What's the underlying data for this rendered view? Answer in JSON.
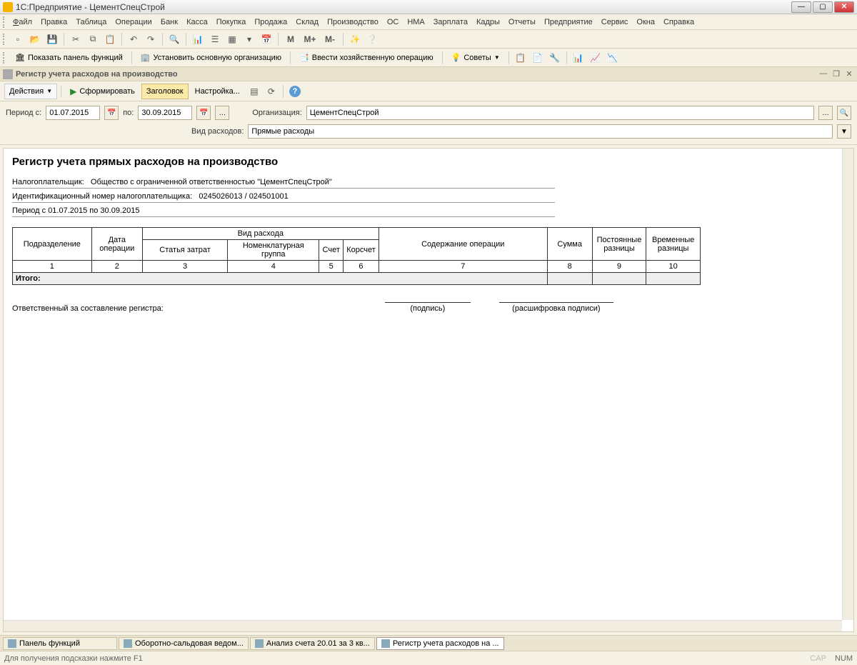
{
  "titlebar": {
    "title": "1С:Предприятие - ЦементСпецСтрой"
  },
  "menu": {
    "items": [
      "Файл",
      "Правка",
      "Таблица",
      "Операции",
      "Банк",
      "Касса",
      "Покупка",
      "Продажа",
      "Склад",
      "Производство",
      "ОС",
      "НМА",
      "Зарплата",
      "Кадры",
      "Отчеты",
      "Предприятие",
      "Сервис",
      "Окна",
      "Справка"
    ]
  },
  "toolbar2": {
    "show_panel": "Показать панель функций",
    "set_org": "Установить основную организацию",
    "enter_op": "Ввести хозяйственную операцию",
    "tips": "Советы"
  },
  "doc_tab": {
    "title": "Регистр учета расходов на производство"
  },
  "actionbar": {
    "actions": "Действия",
    "form": "Сформировать",
    "header": "Заголовок",
    "settings": "Настройка..."
  },
  "filters": {
    "period_from_label": "Период с:",
    "period_from": "01.07.2015",
    "period_to_label": "по:",
    "period_to": "30.09.2015",
    "org_label": "Организация:",
    "org_value": "ЦементСпецСтрой",
    "expense_type_label": "Вид расходов:",
    "expense_type_value": "Прямые расходы"
  },
  "report": {
    "title": "Регистр учета прямых расходов на производство",
    "taxpayer_label": "Налогоплательщик:",
    "taxpayer_value": "Общество с ограниченной ответственностью \"ЦементСпецСтрой\"",
    "inn_label": "Идентификационный номер налогоплательщика:",
    "inn_value": "0245026013 / 024501001",
    "period_line": "Период с 01.07.2015  по 30.09.2015",
    "headers": {
      "dept": "Подразделение",
      "op_date": "Дата операции",
      "exp_type": "Вид расхода",
      "cost_item": "Статья затрат",
      "nomen_group": "Номенклатурная группа",
      "account": "Счет",
      "corr_account": "Корсчет",
      "op_content": "Содержание операции",
      "sum": "Сумма",
      "perm_diff": "Постоянные разницы",
      "temp_diff": "Временные разницы"
    },
    "col_nums": [
      "1",
      "2",
      "3",
      "4",
      "5",
      "6",
      "7",
      "8",
      "9",
      "10"
    ],
    "total_label": "Итого:",
    "resp_label": "Ответственный за составление регистра:",
    "sig1": "(подпись)",
    "sig2": "(расшифровка подписи)"
  },
  "taskbar": {
    "items": [
      "Панель функций",
      "Оборотно-сальдовая ведом...",
      "Анализ счета 20.01 за 3 кв...",
      "Регистр учета расходов на ..."
    ],
    "active_index": 3
  },
  "statusbar": {
    "hint": "Для получения подсказки нажмите F1",
    "cap": "CAP",
    "num": "NUM"
  },
  "mem_btns": [
    "M",
    "M+",
    "M-"
  ]
}
